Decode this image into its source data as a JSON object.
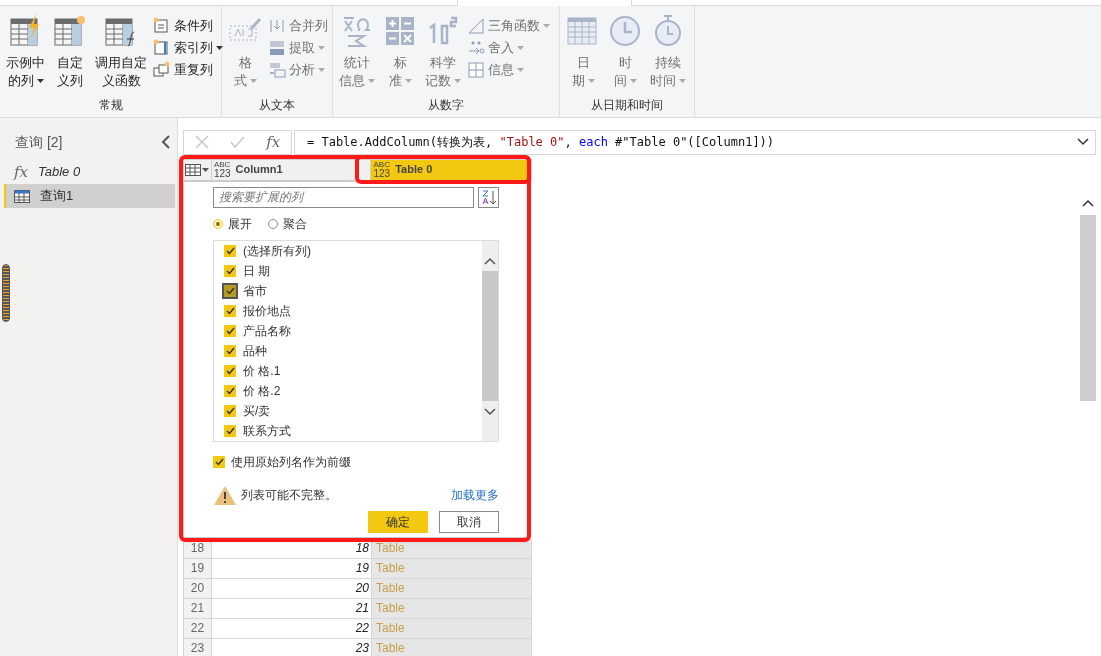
{
  "ribbon": {
    "groups": [
      {
        "label": "常规",
        "large_buttons": [
          {
            "lines": [
              "示例中",
              "的列"
            ],
            "kind": "sheet-flash",
            "dropdown": true,
            "disabled": false
          },
          {
            "lines": [
              "自定",
              "义列"
            ],
            "kind": "sheet-star",
            "dropdown": false,
            "disabled": false
          },
          {
            "lines": [
              "调用自定",
              "义函数"
            ],
            "kind": "sheet-fx",
            "dropdown": false,
            "disabled": false
          }
        ],
        "small_buttons": [
          {
            "label": "条件列",
            "kind": "conditional",
            "dropdown": false,
            "disabled": false
          },
          {
            "label": "索引列",
            "kind": "index",
            "dropdown": true,
            "disabled": false
          },
          {
            "label": "重复列",
            "kind": "duplicate",
            "dropdown": false,
            "disabled": false
          }
        ]
      },
      {
        "label": "从文本",
        "large_buttons": [
          {
            "lines": [
              "格",
              "式"
            ],
            "kind": "format",
            "dropdown": true,
            "disabled": true
          }
        ],
        "small_buttons": [
          {
            "label": "合并列",
            "kind": "merge",
            "dropdown": false,
            "disabled": true
          },
          {
            "label": "提取",
            "kind": "extract",
            "dropdown": true,
            "disabled": true
          },
          {
            "label": "分析",
            "kind": "parse",
            "dropdown": true,
            "disabled": true
          }
        ]
      },
      {
        "label": "从数字",
        "large_buttons": [
          {
            "lines": [
              "统计",
              "信息"
            ],
            "kind": "statistics",
            "dropdown": true,
            "disabled": true
          },
          {
            "lines": [
              "标",
              "准"
            ],
            "kind": "standard",
            "dropdown": true,
            "disabled": true
          },
          {
            "lines": [
              "科学",
              "记数"
            ],
            "kind": "scientific",
            "dropdown": true,
            "disabled": true
          }
        ],
        "small_buttons": [
          {
            "label": "三角函数",
            "kind": "trig",
            "dropdown": true,
            "disabled": true
          },
          {
            "label": "舍入",
            "kind": "round",
            "dropdown": true,
            "disabled": true
          },
          {
            "label": "信息",
            "kind": "info",
            "dropdown": true,
            "disabled": true
          }
        ]
      },
      {
        "label": "从日期和时间",
        "large_buttons": [
          {
            "lines": [
              "日",
              "期"
            ],
            "kind": "calendar",
            "dropdown": true,
            "disabled": true
          },
          {
            "lines": [
              "时",
              "间"
            ],
            "kind": "clock",
            "dropdown": true,
            "disabled": true
          },
          {
            "lines": [
              "持续",
              "时间"
            ],
            "kind": "stopwatch",
            "dropdown": true,
            "disabled": true
          }
        ]
      }
    ]
  },
  "queries": {
    "title": "查询 [2]",
    "items": [
      {
        "label": "Table 0",
        "kind": "function",
        "icon_text": "fx",
        "selected": false
      },
      {
        "label": "查询1",
        "kind": "table",
        "selected": true
      }
    ]
  },
  "formula_buttons": {
    "fx": "fx"
  },
  "formula": [
    {
      "text": "= Table.AddColumn(转换为表, ",
      "kind": "plain"
    },
    {
      "text": "\"Table 0\"",
      "kind": "string"
    },
    {
      "text": ", ",
      "kind": "plain"
    },
    {
      "text": "each",
      "kind": "keyword"
    },
    {
      "text": " #\"Table 0\"([Column1]))",
      "kind": "plain"
    }
  ],
  "table": {
    "columns": [
      {
        "label": "Column1",
        "type_lines": [
          "ABC",
          "123"
        ],
        "selected": false
      },
      {
        "label": "Table 0",
        "type_lines": [
          "ABC",
          "123"
        ],
        "selected": true
      }
    ],
    "rows": [
      {
        "index": "18",
        "column1": "18",
        "table0": "Table"
      },
      {
        "index": "19",
        "column1": "19",
        "table0": "Table"
      },
      {
        "index": "20",
        "column1": "20",
        "table0": "Table"
      },
      {
        "index": "21",
        "column1": "21",
        "table0": "Table"
      },
      {
        "index": "22",
        "column1": "22",
        "table0": "Table"
      },
      {
        "index": "23",
        "column1": "23",
        "table0": "Table"
      }
    ]
  },
  "expand_dialog": {
    "search": {
      "placeholder": "搜索要扩展的列"
    },
    "modes": [
      {
        "label": "展开",
        "selected": true
      },
      {
        "label": "聚合",
        "selected": false
      }
    ],
    "columns": [
      {
        "label": "(选择所有列)",
        "checked": true,
        "hovered": false
      },
      {
        "label": "日 期",
        "checked": true,
        "hovered": false
      },
      {
        "label": "省市",
        "checked": true,
        "hovered": true
      },
      {
        "label": "报价地点",
        "checked": true,
        "hovered": false
      },
      {
        "label": "产品名称",
        "checked": true,
        "hovered": false
      },
      {
        "label": "品种",
        "checked": true,
        "hovered": false
      },
      {
        "label": "价 格.1",
        "checked": true,
        "hovered": false
      },
      {
        "label": "价 格.2",
        "checked": true,
        "hovered": false
      },
      {
        "label": "买/卖",
        "checked": true,
        "hovered": false
      },
      {
        "label": "联系方式",
        "checked": true,
        "hovered": false
      }
    ],
    "prefix": {
      "label": "使用原始列名作为前缀",
      "checked": true
    },
    "warning": "列表可能不完整。",
    "load_more": "加载更多",
    "buttons": [
      {
        "label": "确定",
        "kind": "primary"
      },
      {
        "label": "取消",
        "kind": "secondary"
      }
    ]
  }
}
